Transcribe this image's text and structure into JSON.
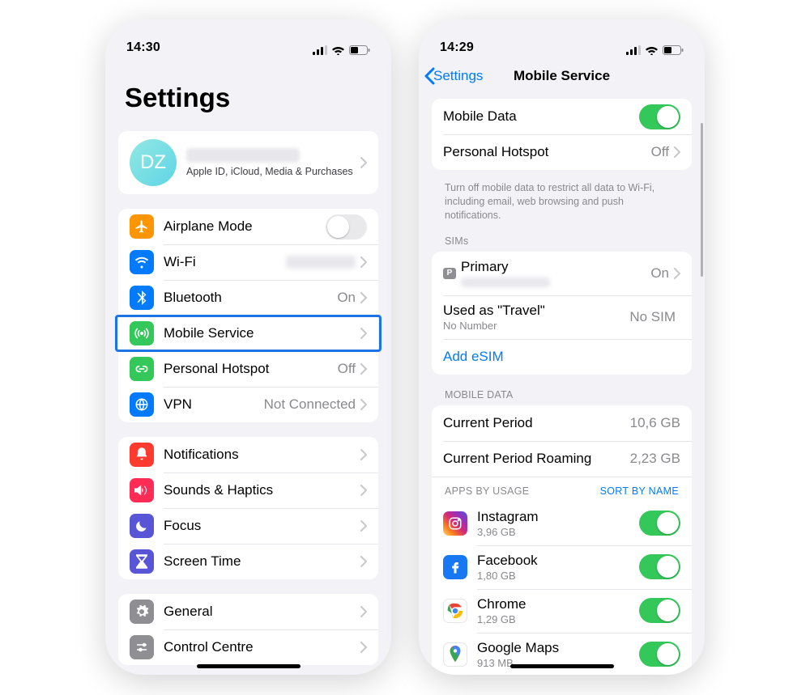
{
  "phone1": {
    "status": {
      "time": "14:30"
    },
    "title": "Settings",
    "apple_id": {
      "initials": "DZ",
      "subtitle": "Apple ID, iCloud, Media & Purchases"
    },
    "groups": [
      {
        "rows": [
          {
            "icon": "airplane",
            "label": "Airplane Mode",
            "accessory": "toggle-off"
          },
          {
            "icon": "wifi",
            "label": "Wi-Fi",
            "detail_blur": true,
            "chevron": true
          },
          {
            "icon": "bluetooth",
            "label": "Bluetooth",
            "detail": "On",
            "chevron": true
          },
          {
            "icon": "antenna",
            "label": "Mobile Service",
            "chevron": true,
            "highlighted": true
          },
          {
            "icon": "hotspot",
            "label": "Personal Hotspot",
            "detail": "Off",
            "chevron": true
          },
          {
            "icon": "vpn",
            "label": "VPN",
            "detail": "Not Connected",
            "chevron": true
          }
        ]
      },
      {
        "rows": [
          {
            "icon": "notifications",
            "label": "Notifications",
            "chevron": true
          },
          {
            "icon": "sounds",
            "label": "Sounds & Haptics",
            "chevron": true
          },
          {
            "icon": "focus",
            "label": "Focus",
            "chevron": true
          },
          {
            "icon": "screentime",
            "label": "Screen Time",
            "chevron": true
          }
        ]
      },
      {
        "rows": [
          {
            "icon": "general",
            "label": "General",
            "chevron": true
          },
          {
            "icon": "control",
            "label": "Control Centre",
            "chevron": true
          }
        ]
      }
    ]
  },
  "phone2": {
    "status": {
      "time": "14:29"
    },
    "back_label": "Settings",
    "title": "Mobile Service",
    "top_rows": [
      {
        "label": "Mobile Data",
        "accessory": "toggle-on"
      },
      {
        "label": "Personal Hotspot",
        "detail": "Off",
        "chevron": true
      }
    ],
    "top_footer": "Turn off mobile data to restrict all data to Wi-Fi, including email, web browsing and push notifications.",
    "sims_header": "SIMs",
    "sims": [
      {
        "badge": "P",
        "label": "Primary",
        "sub_blur": true,
        "detail": "On",
        "chevron": true
      },
      {
        "label": "Used as \"Travel\"",
        "sub": "No Number",
        "detail": "No SIM"
      },
      {
        "label": "Add eSIM",
        "link": true
      }
    ],
    "mobile_data_header": "MOBILE DATA",
    "periods": [
      {
        "label": "Current Period",
        "detail": "10,6 GB"
      },
      {
        "label": "Current Period Roaming",
        "detail": "2,23 GB"
      }
    ],
    "apps_section": {
      "left": "APPS BY USAGE",
      "right": "SORT BY NAME"
    },
    "apps": [
      {
        "icon": "instagram",
        "name": "Instagram",
        "usage": "3,96 GB",
        "toggle": true
      },
      {
        "icon": "facebook",
        "name": "Facebook",
        "usage": "1,80 GB",
        "toggle": true
      },
      {
        "icon": "chrome",
        "name": "Chrome",
        "usage": "1,29 GB",
        "toggle": true
      },
      {
        "icon": "googlemaps",
        "name": "Google Maps",
        "usage": "913 MB",
        "toggle": true
      }
    ]
  }
}
